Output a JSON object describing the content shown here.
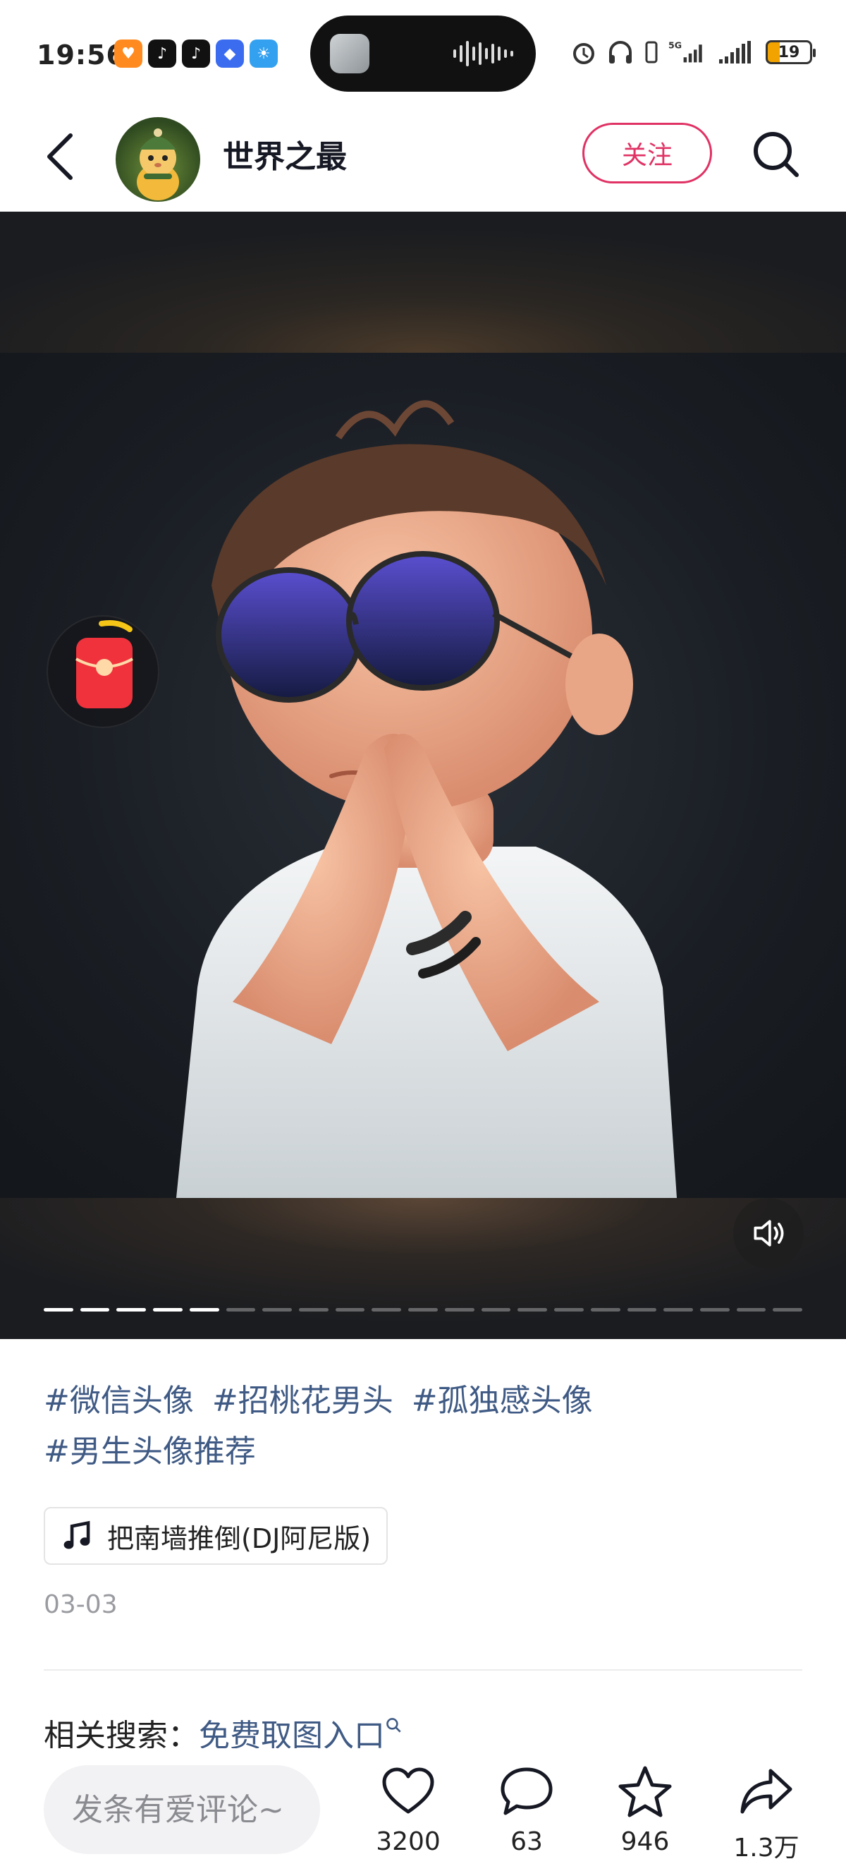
{
  "status_bar": {
    "time": "19:56",
    "battery": "19",
    "network": "5G"
  },
  "header": {
    "author_name": "世界之最",
    "follow_label": "关注"
  },
  "media": {
    "progress_total": 21,
    "progress_current": 5
  },
  "hashtags": [
    "#微信头像",
    "#招桃花男头",
    "#孤独感头像",
    "#男生头像推荐"
  ],
  "music": {
    "title": "把南墙推倒(DJ阿尼版)"
  },
  "date": "03-03",
  "related": {
    "label": "相关搜索：",
    "link": "免费取图入口"
  },
  "bottom_bar": {
    "comment_placeholder": "发条有爱评论~",
    "likes": "3200",
    "comments": "63",
    "favorites": "946",
    "shares": "1.3万"
  },
  "colors": {
    "accent": "#e03264",
    "hashtag": "#3f5a84"
  }
}
